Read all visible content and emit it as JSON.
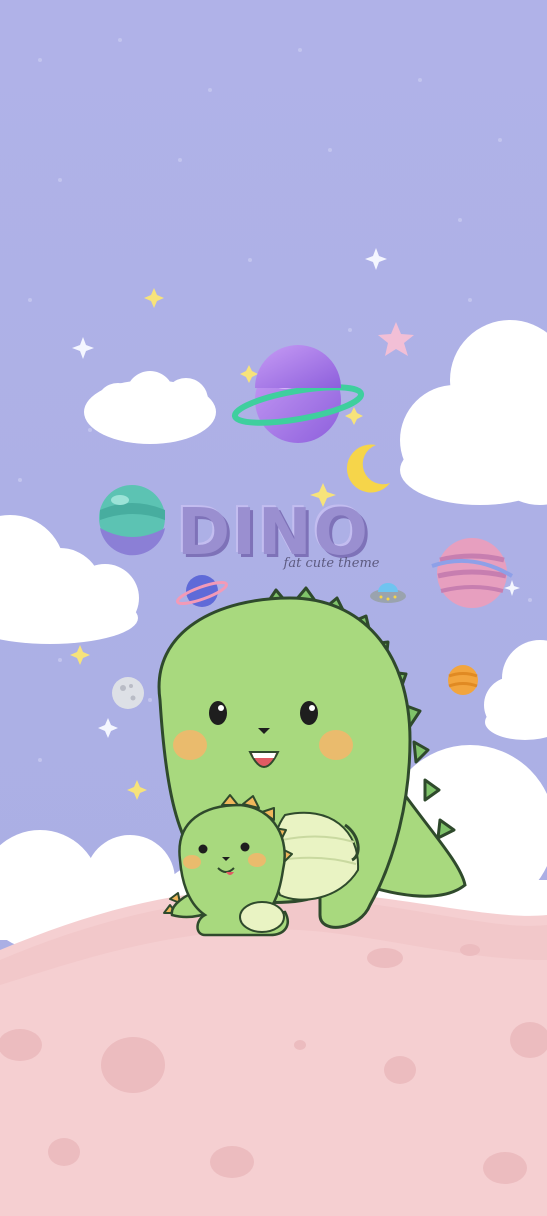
{
  "title": "DINO",
  "subtitle": "fat cute theme",
  "colors": {
    "sky": "#aeb0e6",
    "ground": "#f5cfd1",
    "dino_green": "#a8d97e",
    "cheek": "#f6b56a",
    "purple_planet": "#a67ae8",
    "teal_planet": "#5cc3b3",
    "pink_planet": "#e79fbf"
  },
  "icons": [
    "purple-ringed-planet-icon",
    "teal-planet-icon",
    "pink-striped-planet-icon",
    "blue-planet-icon",
    "moon-icon",
    "crescent-moon-icon",
    "ufo-icon",
    "orange-planet-icon",
    "star-icon"
  ]
}
